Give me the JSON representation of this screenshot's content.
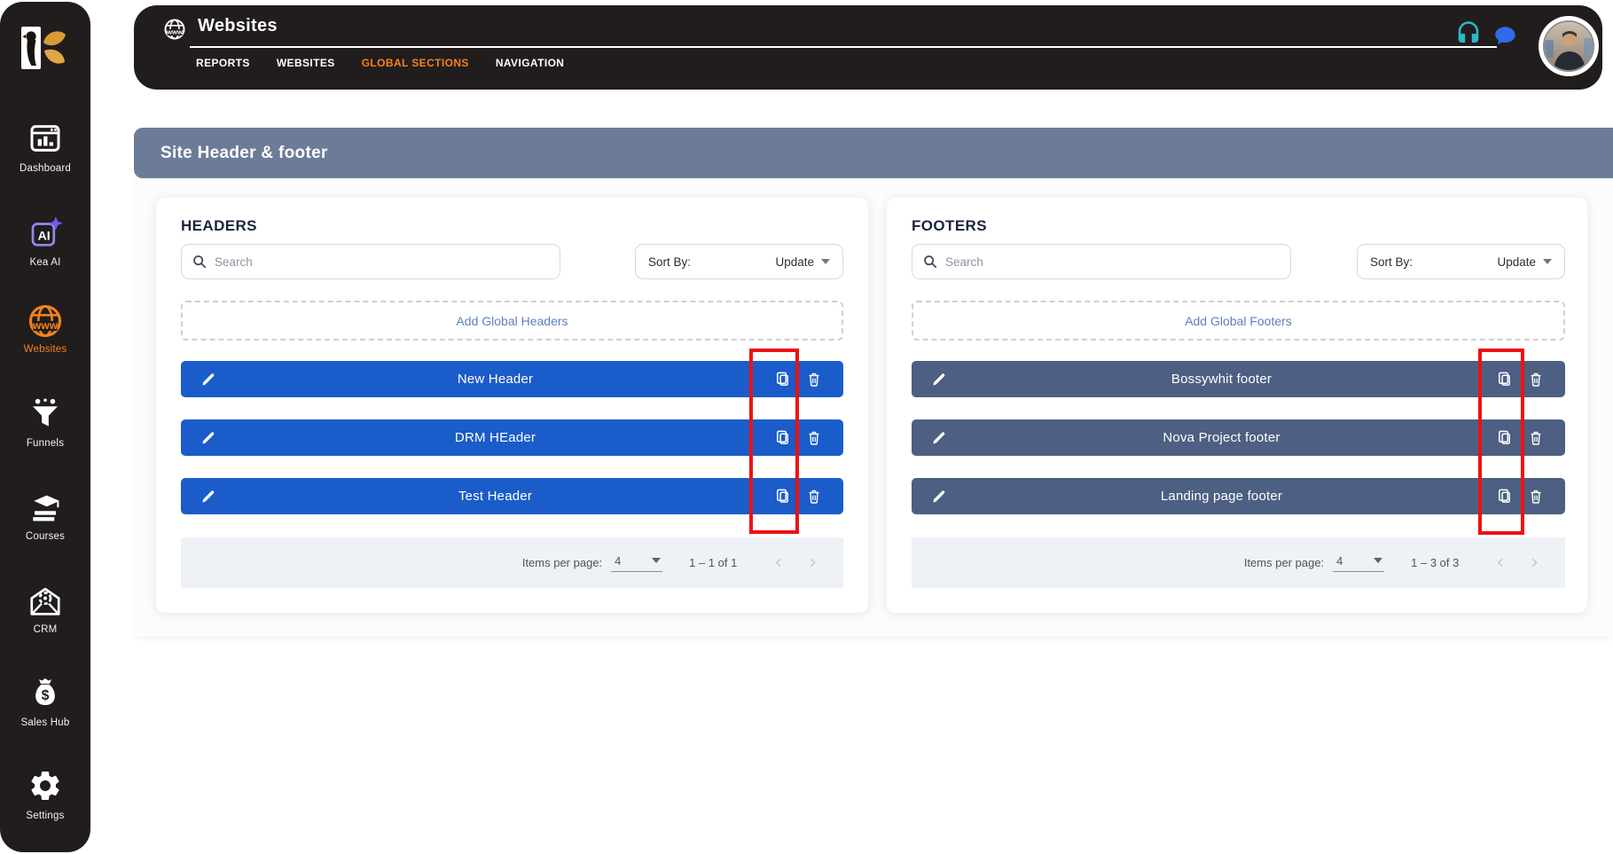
{
  "colors": {
    "accent_orange": "#F5831F",
    "header_row_blue": "#1A5CC9",
    "footer_row_slate": "#4D5F82",
    "banner_slate": "#6C7C98",
    "add_link_blue": "#5B7FBE",
    "annotation_red": "#EE1111",
    "support_teal": "#2CB9C6",
    "chat_blue": "#2F6CE8",
    "sidebar_dark": "#211D1D"
  },
  "sidebar": {
    "items": [
      {
        "label": "Dashboard",
        "icon": "dashboard-icon",
        "active": false
      },
      {
        "label": "Kea AI",
        "icon": "kea-ai-icon",
        "active": false
      },
      {
        "label": "Websites",
        "icon": "globe-www-icon",
        "active": true
      },
      {
        "label": "Funnels",
        "icon": "funnel-icon",
        "active": false
      },
      {
        "label": "Courses",
        "icon": "courses-icon",
        "active": false
      },
      {
        "label": "CRM",
        "icon": "crm-envelope-gear-icon",
        "active": false
      },
      {
        "label": "Sales Hub",
        "icon": "money-bag-icon",
        "active": false
      },
      {
        "label": "Settings",
        "icon": "gear-icon",
        "active": false
      }
    ]
  },
  "topbar": {
    "title": "Websites",
    "tabs": [
      {
        "label": "REPORTS",
        "active": false
      },
      {
        "label": "WEBSITES",
        "active": false
      },
      {
        "label": "GLOBAL SECTIONS",
        "active": true
      },
      {
        "label": "NAVIGATION",
        "active": false
      }
    ]
  },
  "banner": {
    "title": "Site Header & footer"
  },
  "headers_panel": {
    "title": "HEADERS",
    "search_placeholder": "Search",
    "sort_label": "Sort By:",
    "sort_value": "Update",
    "add_button": "Add Global Headers",
    "rows": [
      {
        "title": "New Header"
      },
      {
        "title": "DRM HEader"
      },
      {
        "title": "Test Header"
      }
    ],
    "pagination": {
      "items_per_page_label": "Items per page:",
      "items_per_page": "4",
      "range": "1 – 1 of 1",
      "prev_glyph": "‹",
      "next_glyph": "›"
    }
  },
  "footers_panel": {
    "title": "FOOTERS",
    "search_placeholder": "Search",
    "sort_label": "Sort By:",
    "sort_value": "Update",
    "add_button": "Add Global Footers",
    "rows": [
      {
        "title": "Bossywhit footer"
      },
      {
        "title": "Nova Project footer"
      },
      {
        "title": "Landing page footer"
      }
    ],
    "pagination": {
      "items_per_page_label": "Items per page:",
      "items_per_page": "4",
      "range": "1 – 3 of 3",
      "prev_glyph": "‹",
      "next_glyph": "›"
    }
  }
}
